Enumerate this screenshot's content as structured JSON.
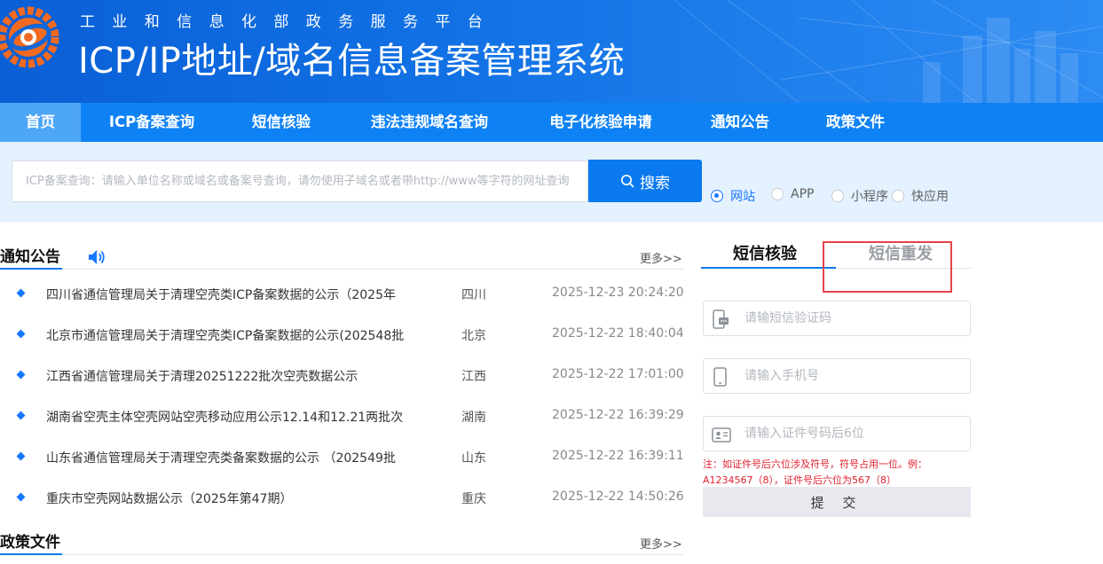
{
  "header": {
    "subtitle": "工业和信息化部政务服务平台",
    "title": "ICP/IP地址/域名信息备案管理系统"
  },
  "nav": {
    "items": [
      {
        "label": "首页",
        "active": true
      },
      {
        "label": "ICP备案查询",
        "active": false
      },
      {
        "label": "短信核验",
        "active": false
      },
      {
        "label": "违法违规域名查询",
        "active": false
      },
      {
        "label": "电子化核验申请",
        "active": false
      },
      {
        "label": "通知公告",
        "active": false
      },
      {
        "label": "政策文件",
        "active": false
      }
    ]
  },
  "search": {
    "placeholder": "ICP备案查询：请输入单位名称或域名或备案号查询，请勿使用子域名或者带http://www等字符的网址查询",
    "button_label": "搜索",
    "types": [
      {
        "label": "网站",
        "selected": true
      },
      {
        "label": "APP",
        "selected": false
      },
      {
        "label": "小程序",
        "selected": false
      },
      {
        "label": "快应用",
        "selected": false
      }
    ]
  },
  "notices": {
    "title": "通知公告",
    "more": "更多>>",
    "items": [
      {
        "title": "四川省通信管理局关于清理空壳类ICP备案数据的公示（2025年",
        "province": "四川",
        "time": "2025-12-23 20:24:20"
      },
      {
        "title": "北京市通信管理局关于清理空壳类ICP备案数据的公示(202548批",
        "province": "北京",
        "time": "2025-12-22 18:40:04"
      },
      {
        "title": "江西省通信管理局关于清理20251222批次空壳数据公示",
        "province": "江西",
        "time": "2025-12-22 17:01:00"
      },
      {
        "title": "湖南省空壳主体空壳网站空壳移动应用公示12.14和12.21两批次",
        "province": "湖南",
        "time": "2025-12-22 16:39:29"
      },
      {
        "title": "山东省通信管理局关于清理空壳类备案数据的公示 （202549批",
        "province": "山东",
        "time": "2025-12-22 16:39:11"
      },
      {
        "title": "重庆市空壳网站数据公示（2025年第47期）",
        "province": "重庆",
        "time": "2025-12-22 14:50:26"
      }
    ]
  },
  "policy": {
    "title": "政策文件",
    "more": "更多>>"
  },
  "sms": {
    "tabs": [
      {
        "label": "短信核验",
        "active": true
      },
      {
        "label": "短信重发",
        "active": false
      }
    ],
    "code_placeholder": "请输短信验证码",
    "phone_placeholder": "请输入手机号",
    "id_placeholder": "请输入证件号码后6位",
    "note": "注：如证件号后六位涉及符号，符号占用一位。例：A1234567（8），证件号后六位为567（8）",
    "submit_label": "提 交"
  },
  "colors": {
    "brand_blue": "#0b7af0",
    "nav_blue": "#0e82f5",
    "highlight_red": "#e6434b",
    "note_red": "#e0202e"
  }
}
